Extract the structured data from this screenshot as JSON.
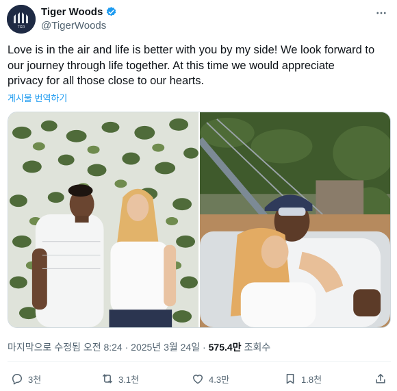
{
  "author": {
    "display_name": "Tiger Woods",
    "handle": "@TigerWoods",
    "avatar_text": "TGR",
    "verified": true
  },
  "tweet": {
    "text": "Love is in the air and life is better with you by my side! We look forward to\nour journey through life together. At this time we would appreciate\nprivacy for all those close to our hearts.",
    "translate_label": "게시물 번역하기"
  },
  "meta": {
    "edited_time": "마지막으로 수정됨 오전 8:24 · 2025년 3월 24일 ·",
    "views_count": "575.4만",
    "views_label": "조회수"
  },
  "actions": {
    "replies": "3천",
    "reposts": "3.1천",
    "likes": "4.3만",
    "bookmarks": "1.8천"
  },
  "colors": {
    "text": "#0f1419",
    "secondary": "#536471",
    "link": "#1d9bf0",
    "verified": "#1d9bf0",
    "avatar_bg": "#1e2a44"
  },
  "icons": [
    "more-icon",
    "verified-badge-icon",
    "reply-icon",
    "repost-icon",
    "like-icon",
    "bookmark-icon",
    "share-icon"
  ]
}
